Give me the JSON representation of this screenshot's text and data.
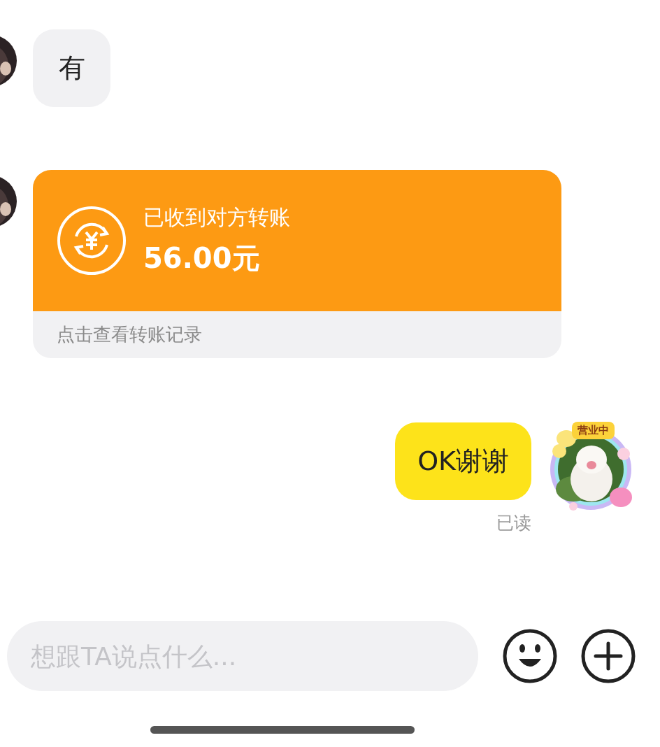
{
  "messages": [
    {
      "outgoing": false,
      "kind": "text",
      "text": "有"
    },
    {
      "outgoing": false,
      "kind": "transfer",
      "title": "已收到对方转账",
      "amount": "56.00元",
      "footer": "点击查看转账记录"
    },
    {
      "outgoing": true,
      "kind": "text",
      "text": "OK谢谢",
      "status": "已读",
      "badge": "营业中"
    }
  ],
  "input": {
    "placeholder": "想跟TA说点什么..."
  }
}
